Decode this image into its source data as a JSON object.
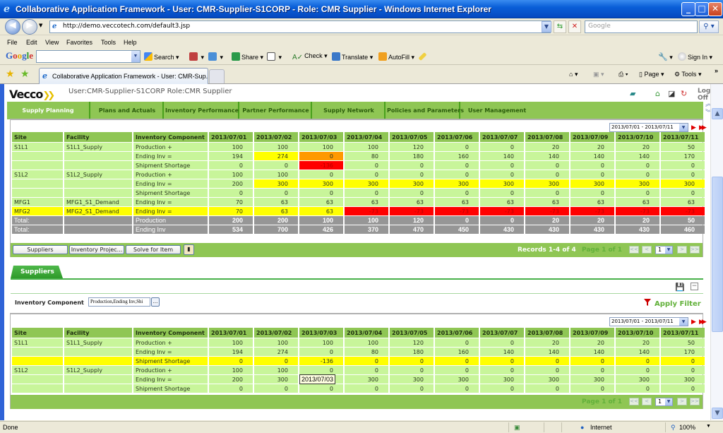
{
  "window": {
    "title": "Collaborative Application Framework - User: CMR-Supplier-S1CORP - Role: CMR Supplier - Windows Internet Explorer",
    "minimize": "_",
    "maximize": "□",
    "close": "✕"
  },
  "addressbar": {
    "url": "http://demo.veccotech.com/default3.jsp",
    "search_placeholder": "Google"
  },
  "menu": [
    "File",
    "Edit",
    "View",
    "Favorites",
    "Tools",
    "Help"
  ],
  "googlebar": {
    "logo": "Google",
    "search": "Search",
    "share": "Share",
    "check": "Check",
    "translate": "Translate",
    "autofill": "AutoFill",
    "signin": "Sign In"
  },
  "browser_tab": {
    "label": "Collaborative Application Framework - User: CMR-Sup..."
  },
  "commandbar": {
    "page": "Page",
    "tools": "Tools"
  },
  "app": {
    "brand": "Vecco",
    "user_info": "User:CMR-Supplier-S1CORP Role:CMR Supplier",
    "logoff": "Log Off",
    "nav": [
      {
        "label": "Supply Planning",
        "active": true
      },
      {
        "label": "Plans and Actuals",
        "active": false
      },
      {
        "label": "Inventory Performance",
        "active": false
      },
      {
        "label": "Partner Performance",
        "active": false
      },
      {
        "label": "Supply Network",
        "active": false
      },
      {
        "label": "Policies and Parameters",
        "active": false
      },
      {
        "label": "User Management",
        "active": false
      }
    ]
  },
  "grid1": {
    "date_range": "2013/07/01 - 2013/07/11",
    "headers": [
      "Site",
      "Facility",
      "Inventory Component",
      "2013/07/01",
      "2013/07/02",
      "2013/07/03",
      "2013/07/04",
      "2013/07/05",
      "2013/07/06",
      "2013/07/07",
      "2013/07/08",
      "2013/07/09",
      "2013/07/10",
      "2013/07/11"
    ],
    "rows": [
      {
        "site": "S1L1",
        "facility": "S1L1_Supply",
        "component": "Production +",
        "values": [
          "100",
          "100",
          "100",
          "100",
          "120",
          "0",
          "0",
          "20",
          "20",
          "20",
          "50"
        ],
        "colors": [
          "",
          "",
          "",
          "",
          "",
          "",
          "",
          "",
          "",
          "",
          ""
        ]
      },
      {
        "site": "",
        "facility": "",
        "component": "Ending Inv =",
        "values": [
          "194",
          "274",
          "0",
          "80",
          "180",
          "160",
          "140",
          "140",
          "140",
          "140",
          "170"
        ],
        "colors": [
          "",
          "yellow",
          "orange",
          "",
          "",
          "",
          "",
          "",
          "",
          "",
          ""
        ]
      },
      {
        "site": "",
        "facility": "",
        "component": "Shipment Shortage",
        "values": [
          "0",
          "0",
          "-136",
          "0",
          "0",
          "0",
          "0",
          "0",
          "0",
          "0",
          "0"
        ],
        "colors": [
          "",
          "",
          "red",
          "",
          "",
          "",
          "",
          "",
          "",
          "",
          ""
        ]
      },
      {
        "site": "S1L2",
        "facility": "S1L2_Supply",
        "component": "Production +",
        "values": [
          "100",
          "100",
          "0",
          "0",
          "0",
          "0",
          "0",
          "0",
          "0",
          "0",
          "0"
        ],
        "colors": [
          "",
          "",
          "",
          "",
          "",
          "",
          "",
          "",
          "",
          "",
          ""
        ]
      },
      {
        "site": "",
        "facility": "",
        "component": "Ending Inv =",
        "values": [
          "200",
          "300",
          "300",
          "300",
          "300",
          "300",
          "300",
          "300",
          "300",
          "300",
          "300"
        ],
        "colors": [
          "",
          "yellow",
          "yellow",
          "yellow",
          "yellow",
          "yellow",
          "yellow",
          "yellow",
          "yellow",
          "yellow",
          "yellow"
        ]
      },
      {
        "site": "",
        "facility": "",
        "component": "Shipment Shortage",
        "values": [
          "0",
          "0",
          "0",
          "0",
          "0",
          "0",
          "0",
          "0",
          "0",
          "0",
          "0"
        ],
        "colors": [
          "",
          "",
          "",
          "",
          "",
          "",
          "",
          "",
          "",
          "",
          ""
        ]
      },
      {
        "site": "MFG1",
        "facility": "MFG1_S1_Demand",
        "component": "Ending Inv =",
        "values": [
          "70",
          "63",
          "63",
          "63",
          "63",
          "63",
          "63",
          "63",
          "63",
          "63",
          "63"
        ],
        "colors": [
          "",
          "",
          "",
          "",
          "",
          "",
          "",
          "",
          "",
          "",
          ""
        ]
      },
      {
        "site": "MFG2",
        "facility": "MFG2_S1_Demand",
        "component": "Ending Inv =",
        "values": [
          "70",
          "63",
          "63",
          "-73",
          "-73",
          "-73",
          "-73",
          "-73",
          "-73",
          "-73",
          "-73"
        ],
        "colors": [
          "yellow",
          "yellow",
          "yellow",
          "red",
          "red",
          "red",
          "red",
          "red",
          "red",
          "red",
          "red"
        ],
        "row_color": "yellow"
      }
    ],
    "totals": [
      {
        "label": "Total:",
        "component": "Production",
        "values": [
          "200",
          "200",
          "100",
          "100",
          "120",
          "0",
          "0",
          "20",
          "20",
          "20",
          "50"
        ]
      },
      {
        "label": "Total:",
        "component": "Ending Inv",
        "values": [
          "534",
          "700",
          "426",
          "370",
          "470",
          "450",
          "430",
          "430",
          "430",
          "430",
          "460"
        ]
      }
    ],
    "buttons": [
      "Suppliers",
      "Inventory Projec...",
      "Solve for Item"
    ],
    "records": "Records 1-4 of 4",
    "page_of": "Page 1 of 1",
    "page_select": "1"
  },
  "suppliers_tab": {
    "label": "Suppliers",
    "filter_label": "Inventory Component",
    "filter_value": "Production,Ending Inv,Shi",
    "filter_button": "...",
    "apply_filter": "Apply Filter"
  },
  "grid2": {
    "date_range": "2013/07/01 - 2013/07/11",
    "headers": [
      "Site",
      "Facility",
      "Inventory Component",
      "2013/07/01",
      "2013/07/02",
      "2013/07/03",
      "2013/07/04",
      "2013/07/05",
      "2013/07/06",
      "2013/07/07",
      "2013/07/08",
      "2013/07/09",
      "2013/07/10",
      "2013/07/11"
    ],
    "rows": [
      {
        "site": "S1L1",
        "facility": "S1L1_Supply",
        "component": "Production +",
        "values": [
          "100",
          "100",
          "100",
          "100",
          "120",
          "0",
          "0",
          "20",
          "20",
          "20",
          "50"
        ]
      },
      {
        "site": "",
        "facility": "",
        "component": "Ending Inv =",
        "values": [
          "194",
          "274",
          "0",
          "80",
          "180",
          "160",
          "140",
          "140",
          "140",
          "140",
          "170"
        ]
      },
      {
        "site": "",
        "facility": "",
        "component": "Shipment Shortage",
        "values": [
          "0",
          "0",
          "-136",
          "0",
          "0",
          "0",
          "0",
          "0",
          "0",
          "0",
          "0"
        ],
        "row_color": "yellow"
      },
      {
        "site": "S1L2",
        "facility": "S1L2_Supply",
        "component": "Production +",
        "values": [
          "100",
          "100",
          "0",
          "0",
          "0",
          "0",
          "0",
          "0",
          "0",
          "0",
          "0"
        ]
      },
      {
        "site": "",
        "facility": "",
        "component": "Ending Inv =",
        "values": [
          "200",
          "300",
          "300",
          "300",
          "300",
          "300",
          "300",
          "300",
          "300",
          "300",
          "300"
        ]
      },
      {
        "site": "",
        "facility": "",
        "component": "Shipment Shortage",
        "values": [
          "0",
          "0",
          "0",
          "0",
          "0",
          "0",
          "0",
          "0",
          "0",
          "0",
          "0"
        ]
      }
    ],
    "page_of": "Page 1 of 1",
    "page_select": "1",
    "tooltip": "2013/07/03"
  },
  "statusbar": {
    "status": "Done",
    "zone": "Internet",
    "zoom": "100%"
  },
  "colors": {
    "nav_green": "#8fc654",
    "cell_green": "#c8f59a",
    "warn_yellow": "#ffff00",
    "warn_orange": "#ff9900",
    "alert_red": "#ff0000",
    "total_gray": "#969696"
  }
}
